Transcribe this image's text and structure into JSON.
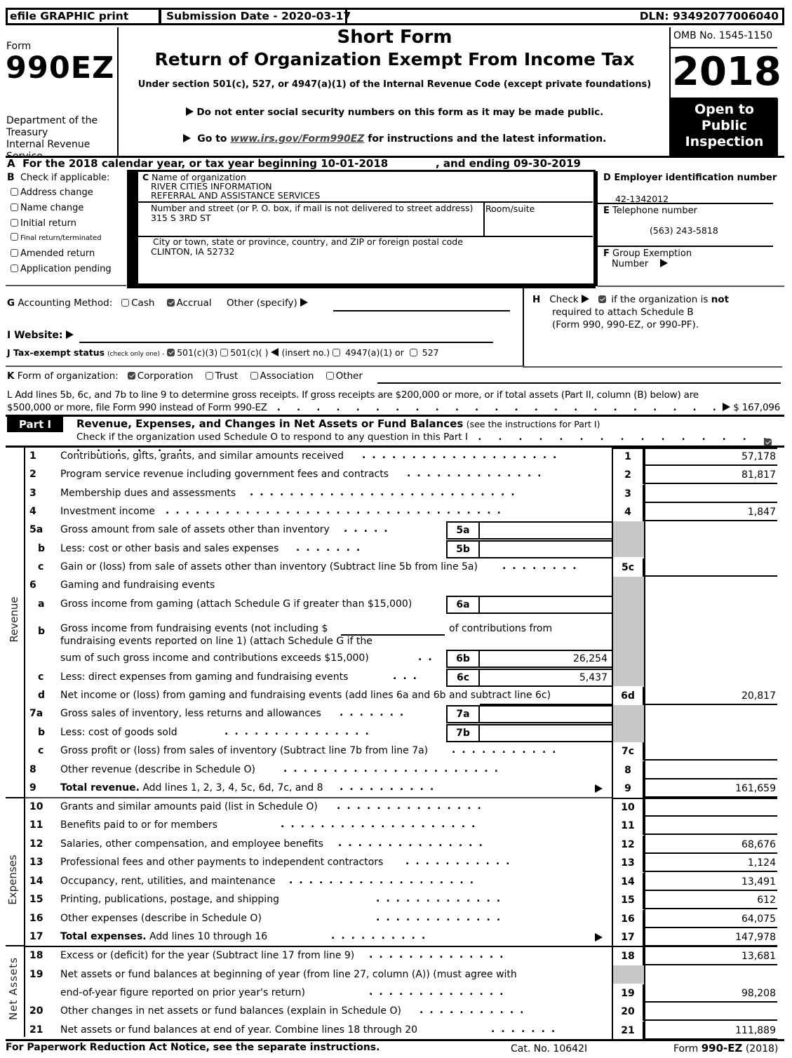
{
  "topbar": {
    "efile": "efile GRAPHIC print",
    "submission": "Submission Date - 2020-03-17",
    "dln": "DLN: 93492077006040"
  },
  "header": {
    "form_label": "Form",
    "form_number": "990EZ",
    "dept": [
      "Department of the",
      "Treasury",
      "Internal Revenue",
      "Service"
    ],
    "title1": "Short Form",
    "title2": "Return of Organization Exempt From Income Tax",
    "subtitle": "Under section 501(c), 527, or 4947(a)(1) of the Internal Revenue Code (except private foundations)",
    "notice1": "Do not enter social security numbers on this form as it may be made public.",
    "notice2_pre": "Go to ",
    "notice2_link": "www.irs.gov/Form990EZ",
    "notice2_post": " for instructions and the latest information.",
    "omb": "OMB No. 1545-1150",
    "year": "2018",
    "open_public": [
      "Open to",
      "Public",
      "Inspection"
    ]
  },
  "line_a": {
    "label": "A",
    "text": "For the 2018 calendar year, or tax year beginning 10-01-2018",
    "ending": ", and ending 09-30-2019"
  },
  "section_b": {
    "label": "B",
    "title": "Check if applicable:",
    "items": [
      {
        "label": "Address change",
        "checked": false
      },
      {
        "label": "Name change",
        "checked": false
      },
      {
        "label": "Initial return",
        "checked": false
      },
      {
        "label": "Final return/terminated",
        "checked": false
      },
      {
        "label": "Amended return",
        "checked": false
      },
      {
        "label": "Application pending",
        "checked": false
      }
    ]
  },
  "section_c": {
    "label": "C",
    "name_label": "Name of organization",
    "name_line1": "RIVER CITIES INFORMATION",
    "name_line2": "REFERRAL AND ASSISTANCE SERVICES",
    "street_label": "Number and street (or P. O. box, if mail is not delivered to street address)",
    "room_label": "Room/suite",
    "street": "315 S 3RD ST",
    "room": "",
    "city_label": "City or town, state or province, country, and ZIP or foreign postal code",
    "city": "CLINTON, IA  52732"
  },
  "section_d": {
    "label": "D",
    "title": "Employer identification number",
    "value": "42-1342012"
  },
  "section_e": {
    "label": "E",
    "title": "Telephone number",
    "value": "(563) 243-5818"
  },
  "section_f": {
    "label": "F",
    "title": "Group Exemption",
    "title2": "Number",
    "value": ""
  },
  "section_g": {
    "label": "G",
    "title": "Accounting Method:",
    "cash": "Cash",
    "cash_checked": false,
    "accrual": "Accrual",
    "accrual_checked": true,
    "other": "Other (specify)",
    "other_value": ""
  },
  "section_h": {
    "label": "H",
    "check": "Check",
    "checked": true,
    "text1": "if the organization is ",
    "text1_bold": "not",
    "text2": "required to attach Schedule B",
    "text3": "(Form 990, 990-EZ, or 990-PF)."
  },
  "section_i": {
    "label": "I Website:",
    "value": ""
  },
  "section_j": {
    "label": "J Tax-exempt status",
    "note": "(check only one) -",
    "opt1": "501(c)(3)",
    "opt1_checked": true,
    "opt2": "501(c)(   )",
    "opt2_checked": false,
    "insert": "(insert no.)",
    "opt3": "4947(a)(1) or",
    "opt3_checked": false,
    "opt4": "527",
    "opt4_checked": false
  },
  "section_k": {
    "label": "K",
    "title": "Form of organization:",
    "options": [
      {
        "label": "Corporation",
        "checked": true
      },
      {
        "label": "Trust",
        "checked": false
      },
      {
        "label": "Association",
        "checked": false
      },
      {
        "label": "Other",
        "checked": false
      }
    ]
  },
  "section_l": {
    "line1": "L Add lines 5b, 6c, and 7b to line 9 to determine gross receipts. If gross receipts are $200,000 or more, or if total assets (Part II, column (B) below) are",
    "line2": "$500,000 or more, file Form 990 instead of Form 990-EZ",
    "value": "$ 167,096"
  },
  "part1": {
    "tag": "Part I",
    "title": "Revenue, Expenses, and Changes in Net Assets or Fund Balances",
    "title_note": "(see the instructions for Part I)",
    "schedule_o": "Check if the organization used Schedule O to respond to any question in this Part I",
    "schedule_o_checked": true,
    "side_labels": {
      "revenue": "Revenue",
      "expenses": "Expenses",
      "net_assets": "Net Assets"
    },
    "lines": {
      "l1": {
        "num": "1",
        "desc": "Contributions, gifts, grants, and similar amounts received",
        "box": "1",
        "amount": "57,178"
      },
      "l2": {
        "num": "2",
        "desc": "Program service revenue including government fees and contracts",
        "box": "2",
        "amount": "81,817"
      },
      "l3": {
        "num": "3",
        "desc": "Membership dues and assessments",
        "box": "3",
        "amount": ""
      },
      "l4": {
        "num": "4",
        "desc": "Investment income",
        "box": "4",
        "amount": "1,847"
      },
      "l5a": {
        "num": "5a",
        "desc": "Gross amount from sale of assets other than inventory",
        "box": "5a",
        "amount": ""
      },
      "l5b": {
        "num": "b",
        "desc": "Less: cost or other basis and sales expenses",
        "box": "5b",
        "amount": ""
      },
      "l5c": {
        "num": "c",
        "desc": "Gain or (loss) from sale of assets other than inventory (Subtract line 5b from line 5a)",
        "box": "5c",
        "amount": ""
      },
      "l6": {
        "num": "6",
        "desc": "Gaming and fundraising events"
      },
      "l6a": {
        "num": "a",
        "desc": "Gross income from gaming (attach Schedule G if greater than $15,000)",
        "box": "6a",
        "amount": ""
      },
      "l6b": {
        "num": "b",
        "desc1": "Gross income from fundraising events (not including $",
        "desc1b": "of contributions from",
        "desc2": "fundraising events reported on line 1) (attach Schedule G if the",
        "desc3": "sum of such gross income and contributions exceeds $15,000)",
        "box": "6b",
        "amount": "26,254",
        "not_including": ""
      },
      "l6c": {
        "num": "c",
        "desc": "Less: direct expenses from gaming and fundraising events",
        "box": "6c",
        "amount": "5,437"
      },
      "l6d": {
        "num": "d",
        "desc": "Net income or (loss) from gaming and fundraising events (add lines 6a and 6b and subtract line 6c)",
        "box": "6d",
        "amount": "20,817"
      },
      "l7a": {
        "num": "7a",
        "desc": "Gross sales of inventory, less returns and allowances",
        "box": "7a",
        "amount": ""
      },
      "l7b": {
        "num": "b",
        "desc": "Less: cost of goods sold",
        "box": "7b",
        "amount": ""
      },
      "l7c": {
        "num": "c",
        "desc": "Gross profit or (loss) from sales of inventory (Subtract line 7b from line 7a)",
        "box": "7c",
        "amount": ""
      },
      "l8": {
        "num": "8",
        "desc": "Other revenue (describe in Schedule O)",
        "box": "8",
        "amount": ""
      },
      "l9": {
        "num": "9",
        "desc_bold": "Total revenue.",
        "desc": " Add lines 1, 2, 3, 4, 5c, 6d, 7c, and 8",
        "box": "9",
        "amount": "161,659"
      },
      "l10": {
        "num": "10",
        "desc": "Grants and similar amounts paid (list in Schedule O)",
        "box": "10",
        "amount": ""
      },
      "l11": {
        "num": "11",
        "desc": "Benefits paid to or for members",
        "box": "11",
        "amount": ""
      },
      "l12": {
        "num": "12",
        "desc": "Salaries, other compensation, and employee benefits",
        "box": "12",
        "amount": "68,676"
      },
      "l13": {
        "num": "13",
        "desc": "Professional fees and other payments to independent contractors",
        "box": "13",
        "amount": "1,124"
      },
      "l14": {
        "num": "14",
        "desc": "Occupancy, rent, utilities, and maintenance",
        "box": "14",
        "amount": "13,491"
      },
      "l15": {
        "num": "15",
        "desc": "Printing, publications, postage, and shipping",
        "box": "15",
        "amount": "612"
      },
      "l16": {
        "num": "16",
        "desc": "Other expenses (describe in Schedule O)",
        "box": "16",
        "amount": "64,075"
      },
      "l17": {
        "num": "17",
        "desc_bold": "Total expenses.",
        "desc": " Add lines 10 through 16",
        "box": "17",
        "amount": "147,978"
      },
      "l18": {
        "num": "18",
        "desc": "Excess or (deficit) for the year (Subtract line 17 from line 9)",
        "box": "18",
        "amount": "13,681"
      },
      "l19": {
        "num": "19",
        "desc1": "Net assets or fund balances at beginning of year (from line 27, column (A)) (must agree with",
        "desc2": "end-of-year figure reported on prior year's return)",
        "box": "19",
        "amount": "98,208"
      },
      "l20": {
        "num": "20",
        "desc": "Other changes in net assets or fund balances (explain in Schedule O)",
        "box": "20",
        "amount": ""
      },
      "l21": {
        "num": "21",
        "desc": "Net assets or fund balances at end of year. Combine lines 18 through 20",
        "box": "21",
        "amount": "111,889"
      }
    }
  },
  "footer": {
    "paperwork": "For Paperwork Reduction Act Notice, see the separate instructions.",
    "cat": "Cat. No. 10642I",
    "form_pre": "Form ",
    "form_bold": "990-EZ",
    "form_post": " (2018)"
  }
}
